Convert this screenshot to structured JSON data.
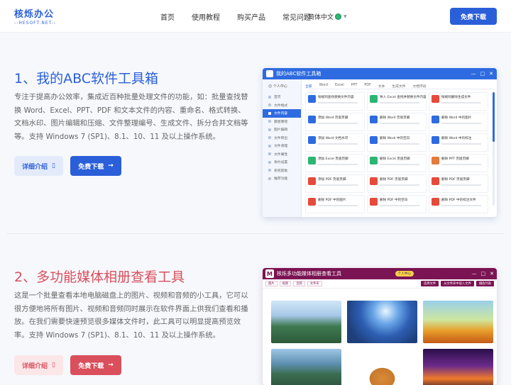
{
  "header": {
    "logo_title": "核烁办公",
    "logo_sub": "--HESOFT.NET--",
    "nav": [
      "首页",
      "使用教程",
      "购买产品",
      "常见问题"
    ],
    "lang": "简体中文",
    "download": "免费下载"
  },
  "sections": [
    {
      "title": "1、我的ABC软件工具箱",
      "desc": "专注于提高办公效率，集成近百种批量处理文件的功能，如：批量查找替换 Word、Excel、PPT、PDF 和文本文件的内容、重命名、格式转换、文档水印、图片编辑和压缩、文件整理编号、生成文件、拆分合并文档等等。支持 Windows 7 (SP1)、8.1、10、11 及以上操作系统。",
      "detail_btn": "详细介绍",
      "download_btn": "免费下载",
      "screenshot": {
        "app_title": "我的ABC软件工具箱",
        "user": "个人中心",
        "sidebar": [
          "首页",
          "文件格式",
          "文件内容",
          "都想要呢",
          "图片编辑",
          "文件转出",
          "文件清理",
          "文件属性",
          "条约设置",
          "系统帮助",
          "推荐功能"
        ],
        "tabs": [
          "全部",
          "Word",
          "Excel",
          "PPT",
          "PDF",
          "文本",
          "生成文件",
          "文档字段"
        ],
        "cards": [
          {
            "name": "按规则查找替换文件内容",
            "color": "#2f6be0"
          },
          {
            "name": "导入 Excel 查找并替换文件内容",
            "color": "#2bb673"
          },
          {
            "name": "按规则删除生成文件",
            "color": "#e64a3b"
          },
          {
            "name": "添加 Word 页眉页脚",
            "color": "#2f6be0"
          },
          {
            "name": "删除 Word 页眉页脚",
            "color": "#2f6be0"
          },
          {
            "name": "删除 Word 中的图片",
            "color": "#2f6be0"
          },
          {
            "name": "添加 Word 文档水印",
            "color": "#2f6be0"
          },
          {
            "name": "删除 Word 中的空白",
            "color": "#2f6be0"
          },
          {
            "name": "删除 Word 中的标注",
            "color": "#2f6be0"
          },
          {
            "name": "添加 Excel 页眉页脚",
            "color": "#2bb673"
          },
          {
            "name": "删除 Excel 页眉页脚",
            "color": "#2bb673"
          },
          {
            "name": "删除 PPT 页眉页脚",
            "color": "#e67a3b"
          },
          {
            "name": "添加 PDF 页眉页脚",
            "color": "#e64a3b"
          },
          {
            "name": "删除 PDF 页眉页脚",
            "color": "#e64a3b"
          },
          {
            "name": "删除 PDF 页眉页脚",
            "color": "#e64a3b"
          },
          {
            "name": "删除 PDF 中的图片",
            "color": "#e64a3b"
          },
          {
            "name": "删除 PDF 中的空白",
            "color": "#e64a3b"
          },
          {
            "name": "删除 PDF 中的标注文件",
            "color": "#e64a3b"
          }
        ]
      }
    },
    {
      "title": "2、多功能媒体相册查看工具",
      "desc": "这是一个批量查看本地电脑磁盘上的图片、视频和音频的小工具，它可以很方便地将所有图片、视频和音频同时展示在软件界面上供我们查看和播放。在我们需要快速预览很多媒体文件时，此工具可以明显提高预览效率。支持 Windows 7 (SP1)、8.1、10、11 及以上操作系统。",
      "detail_btn": "详细介绍",
      "download_btn": "免费下载",
      "screenshot": {
        "app_title": "核烁多功能媒体相册查看工具",
        "m_letter": "M",
        "user": "个人中心",
        "chips": [
          "图片",
          "视频",
          "音频",
          "文件夹"
        ],
        "buttons": [
          "选择文件",
          "从文件夹中读入文件",
          "播放列表"
        ]
      }
    }
  ]
}
